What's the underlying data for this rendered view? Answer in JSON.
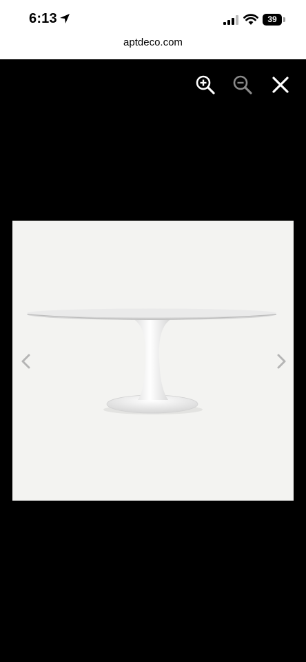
{
  "status_bar": {
    "time": "6:13",
    "battery_level": "39"
  },
  "browser": {
    "url": "aptdeco.com"
  },
  "viewer": {
    "controls": [
      "zoom-in-icon",
      "zoom-out-icon",
      "close-icon"
    ],
    "navigation": [
      "chevron-left-icon",
      "chevron-right-icon"
    ],
    "image_subject": "white oval pedestal table"
  },
  "colors": {
    "background": "#000000",
    "top_bar": "#ffffff",
    "photo_background": "#f3f3f1"
  }
}
